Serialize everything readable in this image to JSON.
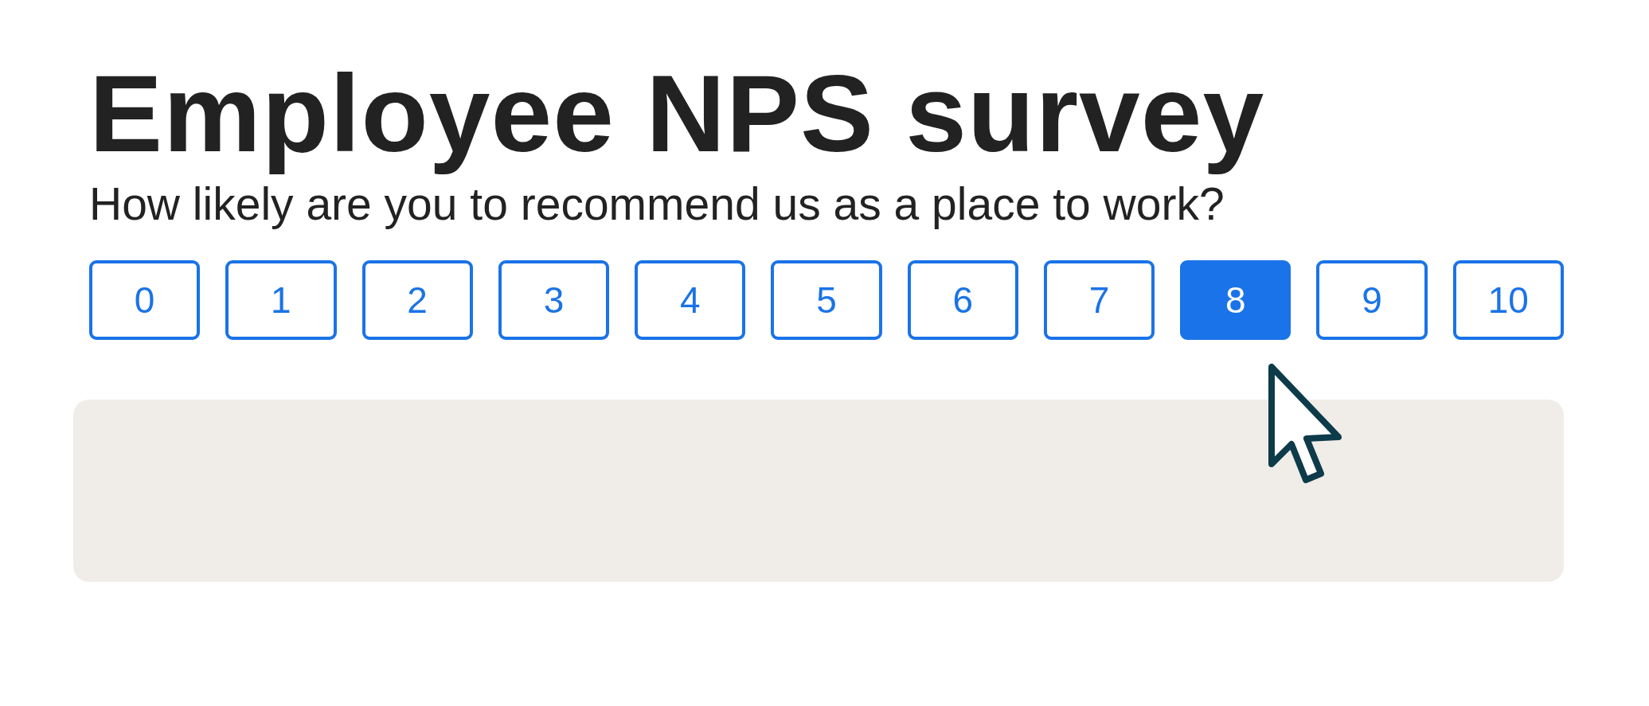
{
  "title": "Employee NPS survey",
  "question": "How likely are you to recommend us as a place to work?",
  "scale": [
    {
      "label": "0",
      "selected": false
    },
    {
      "label": "1",
      "selected": false
    },
    {
      "label": "2",
      "selected": false
    },
    {
      "label": "3",
      "selected": false
    },
    {
      "label": "4",
      "selected": false
    },
    {
      "label": "5",
      "selected": false
    },
    {
      "label": "6",
      "selected": false
    },
    {
      "label": "7",
      "selected": false
    },
    {
      "label": "8",
      "selected": true
    },
    {
      "label": "9",
      "selected": false
    },
    {
      "label": "10",
      "selected": false
    }
  ]
}
